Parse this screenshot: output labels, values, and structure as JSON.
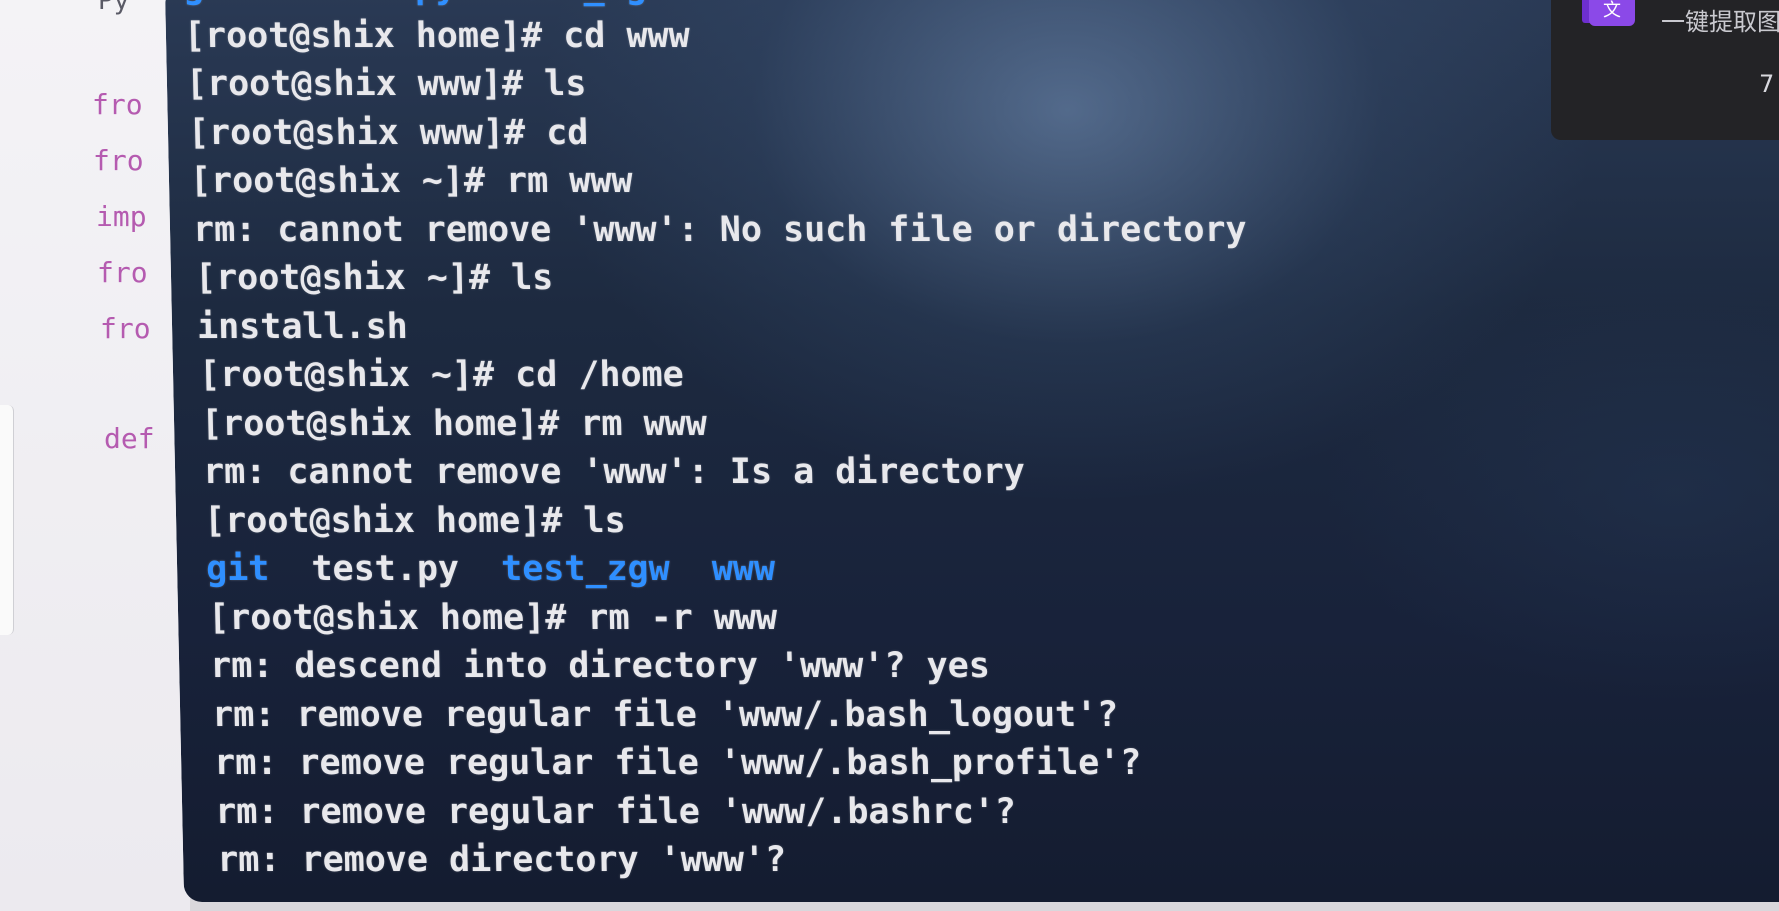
{
  "editor": {
    "tab_fragment": "Py",
    "code_lines": [
      "fro",
      "fro",
      "imp",
      "fro",
      "fro",
      "def"
    ]
  },
  "terminal": {
    "lines": [
      {
        "segments": [
          {
            "text": "git   test.py  test_zgw  www",
            "kind": "partial"
          }
        ]
      },
      {
        "segments": [
          {
            "text": "[root@shix home]# cd www",
            "kind": "plain"
          }
        ]
      },
      {
        "segments": [
          {
            "text": "[root@shix www]# ls",
            "kind": "plain"
          }
        ]
      },
      {
        "segments": [
          {
            "text": "[root@shix www]# cd",
            "kind": "plain"
          }
        ]
      },
      {
        "segments": [
          {
            "text": "[root@shix ~]# rm www",
            "kind": "plain"
          }
        ]
      },
      {
        "segments": [
          {
            "text": "rm: cannot remove 'www': No such file or directory",
            "kind": "plain"
          }
        ]
      },
      {
        "segments": [
          {
            "text": "[root@shix ~]# ls",
            "kind": "plain"
          }
        ]
      },
      {
        "segments": [
          {
            "text": "install.sh",
            "kind": "plain"
          }
        ]
      },
      {
        "segments": [
          {
            "text": "[root@shix ~]# cd /home",
            "kind": "plain"
          }
        ]
      },
      {
        "segments": [
          {
            "text": "[root@shix home]# rm www",
            "kind": "plain"
          }
        ]
      },
      {
        "segments": [
          {
            "text": "rm: cannot remove 'www': Is a directory",
            "kind": "plain"
          }
        ]
      },
      {
        "segments": [
          {
            "text": "[root@shix home]# ls",
            "kind": "plain"
          }
        ]
      },
      {
        "segments": [
          {
            "text": "git",
            "kind": "dir"
          },
          {
            "text": "  test.py  ",
            "kind": "plain"
          },
          {
            "text": "test_zgw",
            "kind": "dir"
          },
          {
            "text": "  ",
            "kind": "plain"
          },
          {
            "text": "www",
            "kind": "dir"
          }
        ]
      },
      {
        "segments": [
          {
            "text": "[root@shix home]# rm -r www",
            "kind": "plain"
          }
        ]
      },
      {
        "segments": [
          {
            "text": "rm: descend into directory 'www'? yes",
            "kind": "plain"
          }
        ]
      },
      {
        "segments": [
          {
            "text": "rm: remove regular file 'www/.bash_logout'?",
            "kind": "plain"
          }
        ]
      },
      {
        "segments": [
          {
            "text": "rm: remove regular file 'www/.bash_profile'?",
            "kind": "plain"
          }
        ]
      },
      {
        "segments": [
          {
            "text": "rm: remove regular file 'www/.bashrc'?",
            "kind": "plain"
          }
        ]
      },
      {
        "segments": [
          {
            "text": "rm: remove directory 'www'?",
            "kind": "plain"
          }
        ]
      }
    ]
  },
  "popup": {
    "icon": "translate-icon",
    "icon_glyph": "文",
    "title": "一键提取图",
    "sub": "7",
    "accent": "#8b49e8"
  },
  "colors": {
    "terminal_text": "#e8e8ec",
    "directory": "#2f8fff",
    "editor_keyword": "#b55bb0"
  }
}
